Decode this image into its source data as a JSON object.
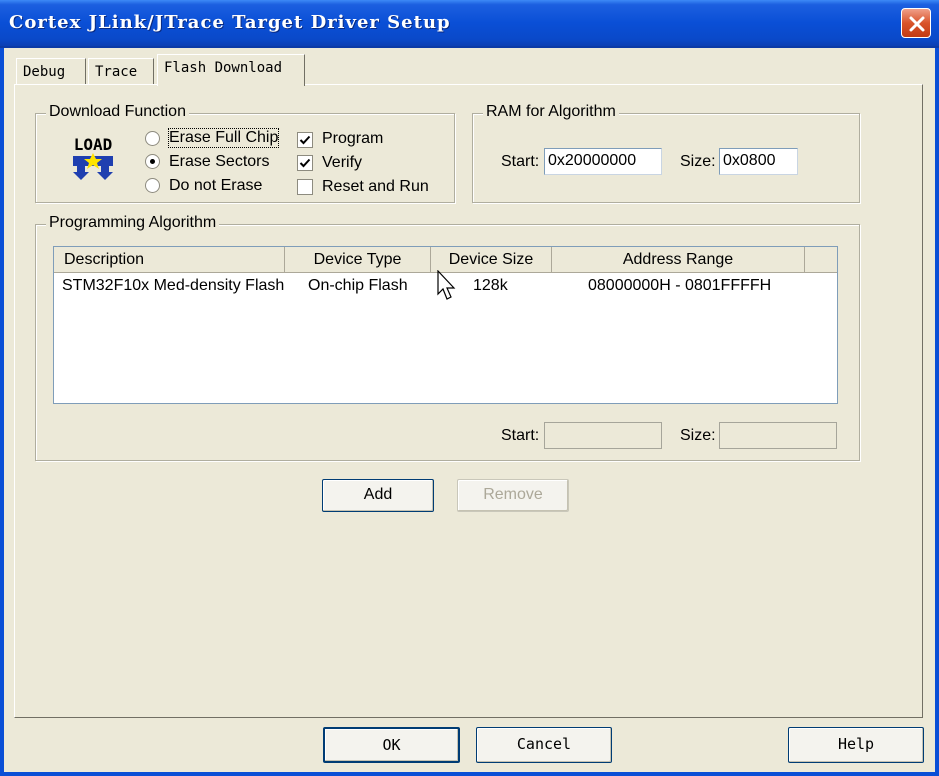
{
  "window": {
    "title": "Cortex JLink/JTrace Target Driver Setup"
  },
  "tabs": [
    {
      "label": "Debug"
    },
    {
      "label": "Trace"
    },
    {
      "label": "Flash Download"
    }
  ],
  "download_function": {
    "group_label": "Download Function",
    "icon_text": "LOAD",
    "radios": [
      {
        "label": "Erase Full Chip",
        "checked": false
      },
      {
        "label": "Erase Sectors",
        "checked": true
      },
      {
        "label": "Do not Erase",
        "checked": false
      }
    ],
    "checks": [
      {
        "label": "Program",
        "checked": true
      },
      {
        "label": "Verify",
        "checked": true
      },
      {
        "label": "Reset and Run",
        "checked": false
      }
    ]
  },
  "ram": {
    "group_label": "RAM for Algorithm",
    "start_label": "Start:",
    "start_value": "0x20000000",
    "size_label": "Size:",
    "size_value": "0x0800"
  },
  "programming": {
    "group_label": "Programming Algorithm",
    "columns": [
      "Description",
      "Device Type",
      "Device Size",
      "Address Range"
    ],
    "rows": [
      {
        "description": "STM32F10x Med-density Flash",
        "device_type": "On-chip Flash",
        "device_size": "128k",
        "address_range": "08000000H - 0801FFFFH"
      }
    ],
    "start_label": "Start:",
    "start_value": "",
    "size_label": "Size:",
    "size_value": ""
  },
  "buttons": {
    "add": "Add",
    "remove": "Remove",
    "ok": "OK",
    "cancel": "Cancel",
    "help": "Help"
  }
}
